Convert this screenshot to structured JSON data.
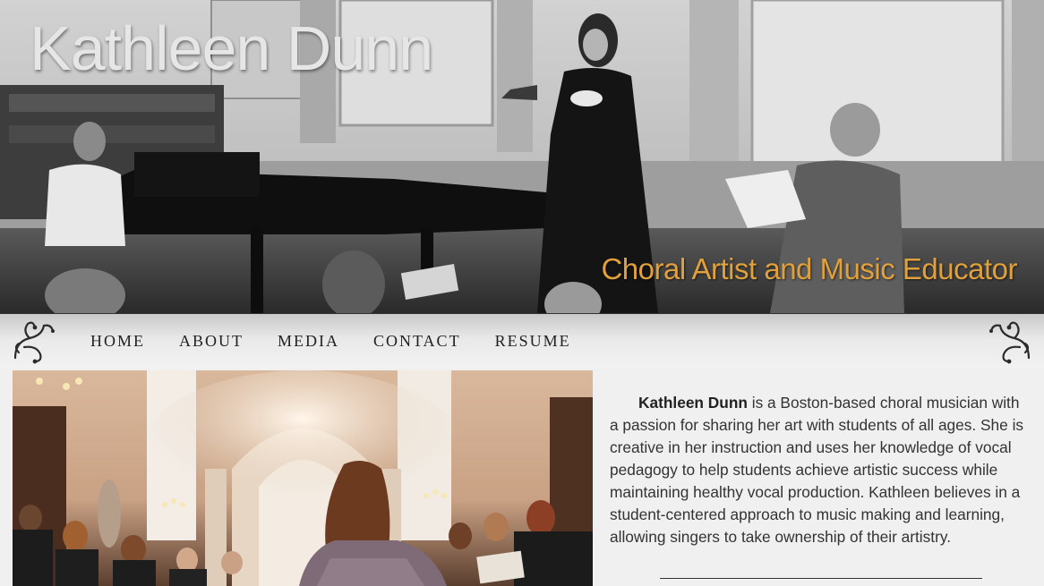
{
  "header": {
    "title": "Kathleen Dunn",
    "subtitle": "Choral Artist and Music Educator"
  },
  "nav": {
    "items": [
      {
        "label": "HOME"
      },
      {
        "label": "ABOUT"
      },
      {
        "label": "MEDIA"
      },
      {
        "label": "CONTACT"
      },
      {
        "label": "RESUME"
      }
    ]
  },
  "bio": {
    "name": "Kathleen Dunn",
    "text": " is a Boston-based choral musician with a passion for sharing her art with students of all ages. She is creative in her instruction and uses her knowledge of vocal pedagogy to help students achieve artistic success while maintaining healthy vocal production. Kathleen believes in a student-centered approach to music making and learning, allowing singers to take ownership of their artistry."
  },
  "colors": {
    "subtitle_accent": "#e0a13c",
    "title": "#e6e6e6",
    "body_text": "#333333"
  },
  "icons": {
    "nav_ornament": "flourish-ornament-icon"
  }
}
